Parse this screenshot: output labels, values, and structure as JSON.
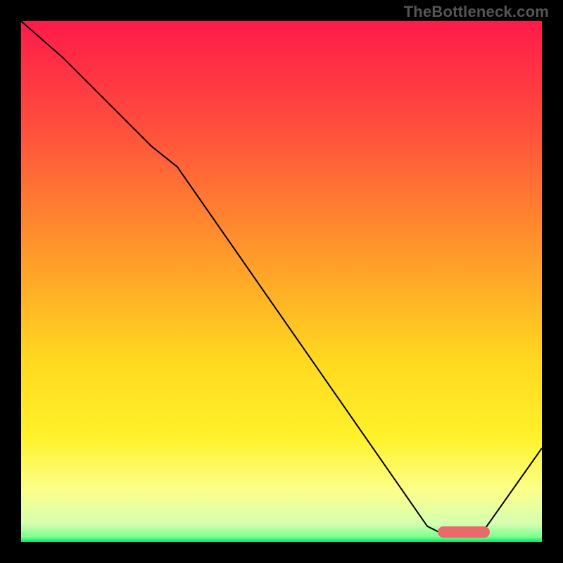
{
  "watermark": "TheBottleneck.com",
  "chart_data": {
    "type": "line",
    "title": "",
    "xlabel": "",
    "ylabel": "",
    "xlim": [
      0,
      100
    ],
    "ylim": [
      0,
      100
    ],
    "grid": false,
    "legend": false,
    "x": [
      0,
      8,
      25,
      30,
      78,
      82,
      88,
      100
    ],
    "values": [
      100,
      93,
      76,
      72,
      3,
      1,
      1,
      18
    ],
    "series_name": "bottleneck-curve",
    "line_color": "#000000",
    "line_width": 2,
    "minimum_region_x": [
      80,
      90
    ],
    "minimum_marker_color": "#e96a6a",
    "background_gradient": [
      {
        "pos": 0.0,
        "color": "#ff1a4a"
      },
      {
        "pos": 0.2,
        "color": "#ff4d3d"
      },
      {
        "pos": 0.45,
        "color": "#ff9a2a"
      },
      {
        "pos": 0.65,
        "color": "#ffd81f"
      },
      {
        "pos": 0.8,
        "color": "#fff22a"
      },
      {
        "pos": 0.9,
        "color": "#fcff8a"
      },
      {
        "pos": 0.965,
        "color": "#d6ffb0"
      },
      {
        "pos": 0.99,
        "color": "#7eff8d"
      },
      {
        "pos": 1.0,
        "color": "#00e56b"
      }
    ]
  }
}
